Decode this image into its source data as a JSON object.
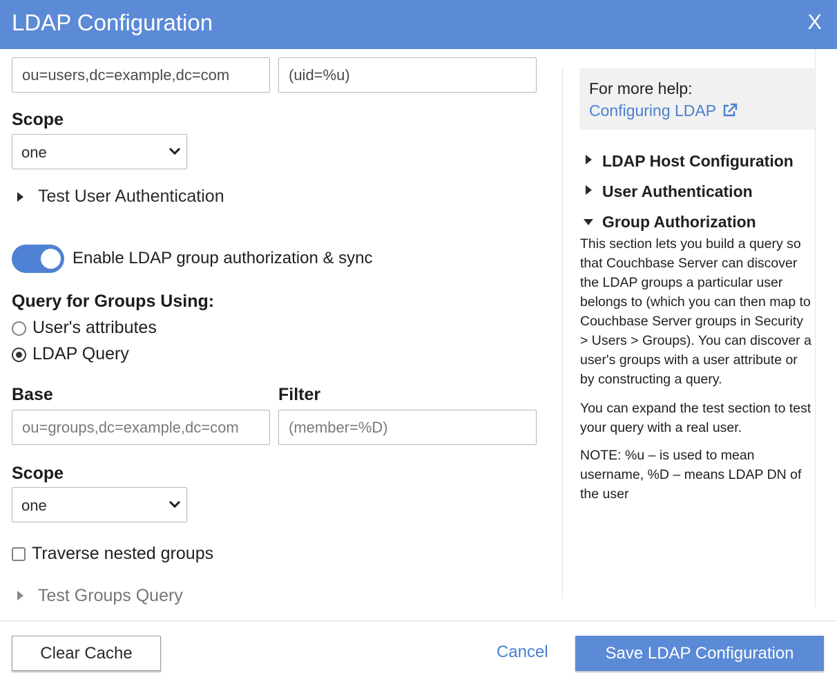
{
  "header": {
    "title": "LDAP Configuration",
    "close_label": "X"
  },
  "user_auth": {
    "base_value": "ou=users,dc=example,dc=com",
    "filter_value": "(uid=%u)",
    "scope_label": "Scope",
    "scope_value": "one",
    "test_label": "Test User Authentication"
  },
  "group_auth": {
    "toggle_label": "Enable LDAP group authorization & sync",
    "toggle_on": true,
    "query_heading": "Query for Groups Using:",
    "options": [
      "User's attributes",
      "LDAP Query"
    ],
    "selected_option": "LDAP Query",
    "base_label": "Base",
    "base_placeholder": "ou=groups,dc=example,dc=com",
    "filter_label": "Filter",
    "filter_placeholder": "(member=%D)",
    "scope_label": "Scope",
    "scope_value": "one",
    "nested_label": "Traverse nested groups",
    "test_label": "Test Groups Query"
  },
  "sidebar": {
    "help_text": "For more help:",
    "help_link": "Configuring LDAP",
    "items": [
      {
        "label": "LDAP Host Configuration",
        "expanded": false
      },
      {
        "label": "User Authentication",
        "expanded": false
      },
      {
        "label": "Group Authorization",
        "expanded": true
      }
    ],
    "paragraphs": [
      "This section lets you build a query so that Couchbase Server can discover the LDAP groups a particular user belongs to (which you can then map to Couchbase Server groups in Security > Users > Groups). You can discover a user's groups with a user attribute or by constructing a query.",
      "You can expand the test section to test your query with a real user.",
      "NOTE: %u – is used to mean username, %D – means LDAP DN of the user"
    ]
  },
  "footer": {
    "clear_cache": "Clear Cache",
    "cancel": "Cancel",
    "save": "Save LDAP Configuration"
  },
  "colors": {
    "header_bg": "#5b8ad6",
    "link": "#4a7fd0",
    "toggle_on": "#4f82d4"
  }
}
